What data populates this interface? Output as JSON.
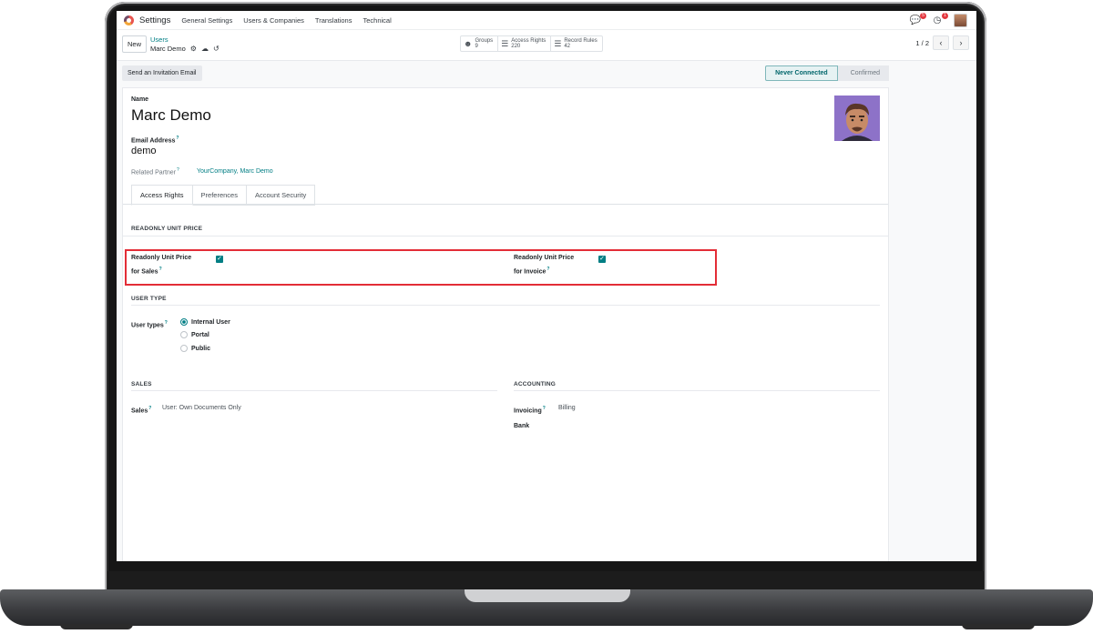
{
  "navbar": {
    "app_name": "Settings",
    "menu": [
      "General Settings",
      "Users & Companies",
      "Translations",
      "Technical"
    ],
    "chat_badge": "5",
    "activity_badge": "1"
  },
  "control": {
    "new_label": "New",
    "breadcrumb_parent": "Users",
    "breadcrumb_current": "Marc Demo",
    "smart_buttons": [
      {
        "label": "Groups",
        "count": "9"
      },
      {
        "label": "Access Rights",
        "count": "220"
      },
      {
        "label": "Record Rules",
        "count": "42"
      }
    ],
    "pager": "1 / 2"
  },
  "form": {
    "invite_label": "Send an Invitation Email",
    "status": [
      "Never Connected",
      "Confirmed"
    ],
    "name_label": "Name",
    "name_value": "Marc Demo",
    "email_label": "Email Address",
    "email_value": "demo",
    "partner_label": "Related Partner",
    "partner_value": "YourCompany, Marc Demo",
    "help_mark": "?",
    "tabs": [
      "Access Rights",
      "Preferences",
      "Account Security"
    ]
  },
  "readonly": {
    "title": "READONLY UNIT PRICE",
    "sales_line1": "Readonly Unit Price",
    "sales_line2": "for Sales",
    "invoice_line1": "Readonly Unit Price",
    "invoice_line2": "for Invoice",
    "sales_checked": true,
    "invoice_checked": true
  },
  "user_type": {
    "title": "USER TYPE",
    "label": "User types",
    "options": [
      "Internal User",
      "Portal",
      "Public"
    ],
    "selected": "Internal User"
  },
  "sales": {
    "title": "SALES",
    "label": "Sales",
    "value": "User: Own Documents Only"
  },
  "accounting": {
    "title": "ACCOUNTING",
    "invoicing_label": "Invoicing",
    "invoicing_value": "Billing",
    "bank_label": "Bank"
  },
  "colors": {
    "accent": "#017e84",
    "highlight": "#e32d37",
    "badge": "#e3383f"
  }
}
